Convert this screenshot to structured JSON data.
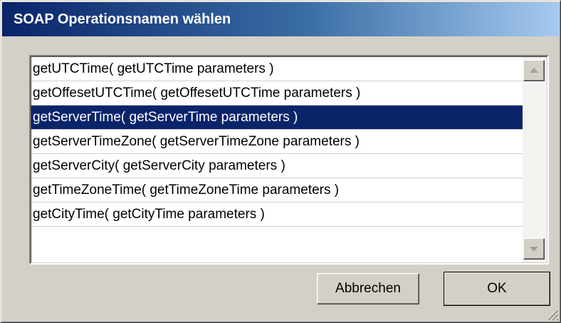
{
  "window": {
    "title": "SOAP Operationsnamen wählen"
  },
  "operations_list": {
    "items": [
      {
        "label": "getUTCTime( getUTCTime parameters )",
        "selected": false
      },
      {
        "label": "getOffesetUTCTime( getOffesetUTCTime parameters )",
        "selected": false
      },
      {
        "label": "getServerTime( getServerTime parameters )",
        "selected": true
      },
      {
        "label": "getServerTimeZone( getServerTimeZone parameters )",
        "selected": false
      },
      {
        "label": "getServerCity( getServerCity parameters )",
        "selected": false
      },
      {
        "label": "getTimeZoneTime( getTimeZoneTime parameters )",
        "selected": false
      },
      {
        "label": "getCityTime( getCityTime parameters )",
        "selected": false
      }
    ]
  },
  "buttons": {
    "cancel_label": "Abbrechen",
    "ok_label": "OK"
  },
  "colors": {
    "titlebar_start": "#0a246a",
    "titlebar_end": "#a6caf0",
    "selection": "#0a246a",
    "dialog_face": "#d4d0c8"
  },
  "icons": {
    "scroll_up": "triangle-up-icon",
    "scroll_down": "triangle-down-icon",
    "resize_grip": "resize-grip-icon"
  }
}
